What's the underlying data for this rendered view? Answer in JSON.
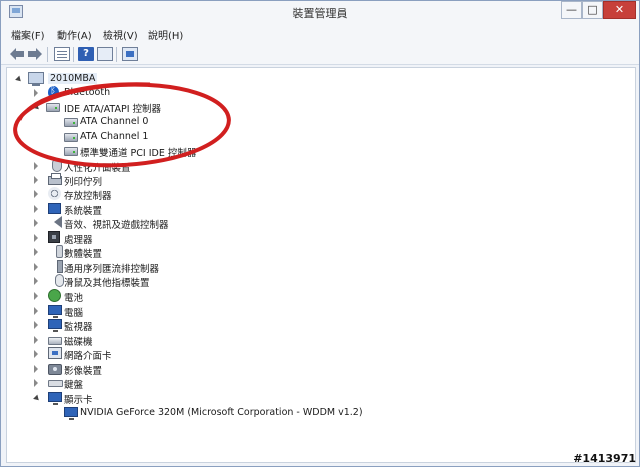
{
  "window": {
    "title": "裝置管理員",
    "minimize_label": "—",
    "maximize_label": "□",
    "close_label": "✕"
  },
  "menu": {
    "file": "檔案(F)",
    "action": "動作(A)",
    "view": "檢視(V)",
    "help": "說明(H)"
  },
  "toolbar": {
    "back_icon": "arrow-left-icon",
    "forward_icon": "arrow-right-icon",
    "properties_icon": "properties-icon",
    "help_label": "?",
    "view_icon": "view-icon",
    "scan_icon": "scan-hardware-icon"
  },
  "tree": {
    "root": "2010MBA",
    "bluetooth": "Bluetooth",
    "ide_category": "IDE ATA/ATAPI 控制器",
    "ide_children": [
      "ATA Channel 0",
      "ATA Channel 1",
      "標準雙通道 PCI IDE 控制器"
    ],
    "categories": [
      "人性化介面裝置",
      "列印佇列",
      "存放控制器",
      "系統裝置",
      "音效、視訊及遊戲控制器",
      "處理器",
      "數體裝置",
      "通用序列匯流排控制器",
      "滑鼠及其他指標裝置",
      "電池",
      "電腦",
      "監視器",
      "磁碟機",
      "網路介面卡",
      "影像裝置",
      "鍵盤"
    ],
    "display_category": "顯示卡",
    "display_child": "NVIDIA GeForce 320M (Microsoft Corporation - WDDM v1.2)"
  },
  "watermark": "#1413971",
  "colors": {
    "annotation_red": "#d11f1f",
    "close_button": "#c7403a"
  }
}
